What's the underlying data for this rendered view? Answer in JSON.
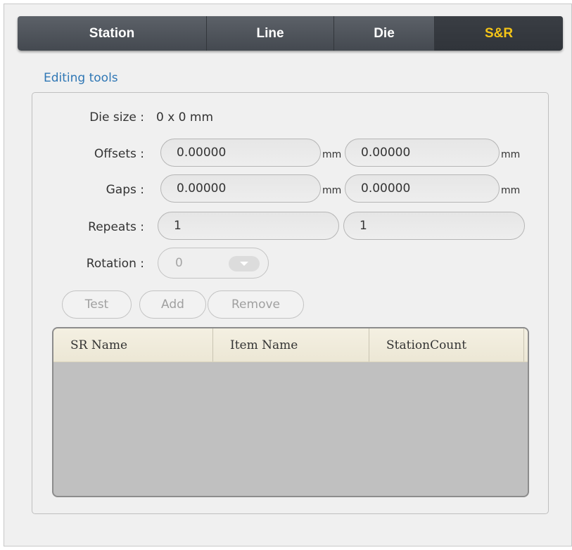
{
  "tabs": [
    {
      "label": "Station",
      "active": false
    },
    {
      "label": "Line",
      "active": false
    },
    {
      "label": "Die",
      "active": false
    },
    {
      "label": "S&R",
      "active": true
    }
  ],
  "colors": {
    "active_tab": "#f4c417",
    "group_title": "#2f77b5",
    "tab_bar": "#4a4f56"
  },
  "editing_tools": {
    "title": "Editing tools",
    "die_size_label": "Die size :",
    "die_size_value": "0 x 0 mm",
    "offsets": {
      "label": "Offsets :",
      "x": "0.00000",
      "y": "0.00000",
      "unit": "mm"
    },
    "gaps": {
      "label": "Gaps :",
      "x": "0.00000",
      "y": "0.00000",
      "unit": "mm"
    },
    "repeats": {
      "label": "Repeats :",
      "x": "1",
      "y": "1"
    },
    "rotation": {
      "label": "Rotation :",
      "value": "0",
      "icon": "chevron-down-icon"
    },
    "buttons": {
      "test": "Test",
      "add": "Add",
      "remove": "Remove"
    }
  },
  "table": {
    "columns": [
      "SR Name",
      "Item Name",
      "StationCount"
    ],
    "rows": []
  }
}
